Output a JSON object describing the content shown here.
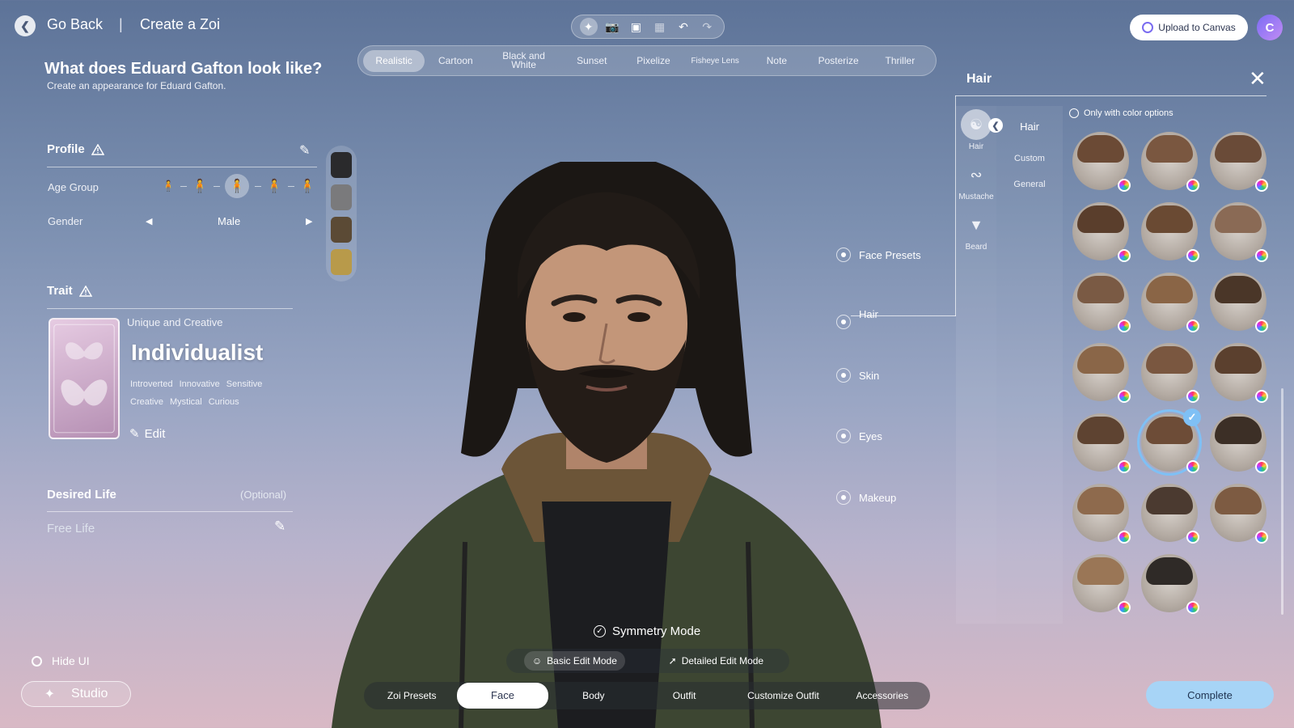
{
  "header": {
    "go_back": "Go Back",
    "separator": "|",
    "title": "Create a Zoi",
    "upload_label": "Upload to Canvas",
    "avatar_initial": "C"
  },
  "toolbar": {
    "tools": [
      "sparkle-icon",
      "camera-icon",
      "focus-icon",
      "frame-icon",
      "undo-icon",
      "redo-icon"
    ]
  },
  "filters": [
    {
      "label": "Realistic",
      "active": true
    },
    {
      "label": "Cartoon"
    },
    {
      "label": "Black and White"
    },
    {
      "label": "Sunset"
    },
    {
      "label": "Pixelize"
    },
    {
      "label": "Fisheye Lens"
    },
    {
      "label": "Note"
    },
    {
      "label": "Posterize"
    },
    {
      "label": "Thriller"
    }
  ],
  "left": {
    "question": "What does Eduard Gafton look like?",
    "subtitle": "Create an appearance for Eduard Gafton.",
    "profile": {
      "title": "Profile",
      "age_label": "Age Group",
      "gender_label": "Gender",
      "gender_value": "Male"
    },
    "trait": {
      "title": "Trait",
      "subtitle": "Unique and Creative",
      "name": "Individualist",
      "tags_row1": [
        "Introverted",
        "Innovative",
        "Sensitive"
      ],
      "tags_row2": [
        "Creative",
        "Mystical",
        "Curious"
      ],
      "edit_label": "Edit"
    },
    "desired_life": {
      "title": "Desired Life",
      "optional": "(Optional)",
      "value": "Free Life"
    },
    "hide_ui": "Hide UI",
    "studio": "Studio"
  },
  "categories": {
    "face_presets": "Face Presets",
    "hair": "Hair",
    "skin": "Skin",
    "eyes": "Eyes",
    "makeup": "Makeup"
  },
  "hair_panel": {
    "title": "Hair",
    "types": {
      "hair": "Hair",
      "mustache": "Mustache",
      "beard": "Beard"
    },
    "subcategories": {
      "header": "Hair",
      "custom": "Custom",
      "general": "General"
    },
    "color_option": "Only with color options",
    "selected_index": 13,
    "styles": [
      "#6b4a35",
      "#7a5740",
      "#6a4b38",
      "#5a3e2c",
      "#6a4a33",
      "#8a6a55",
      "#7a5a44",
      "#8a6546",
      "#4a3628",
      "#8a6648",
      "#7a5740",
      "#5b402e",
      "#5e4331",
      "#6d4c37",
      "#3c2f26",
      "#8e6a4d",
      "#4b3a30",
      "#7d5b42",
      "#9a7656",
      "#2f2a27"
    ]
  },
  "bottom": {
    "symmetry": "Symmetry Mode",
    "basic_mode": "Basic Edit Mode",
    "detailed_mode": "Detailed Edit Mode",
    "tabs": [
      "Zoi Presets",
      "Face",
      "Body",
      "Outfit",
      "Customize Outfit",
      "Accessories"
    ],
    "active_tab": "Face",
    "complete": "Complete"
  }
}
